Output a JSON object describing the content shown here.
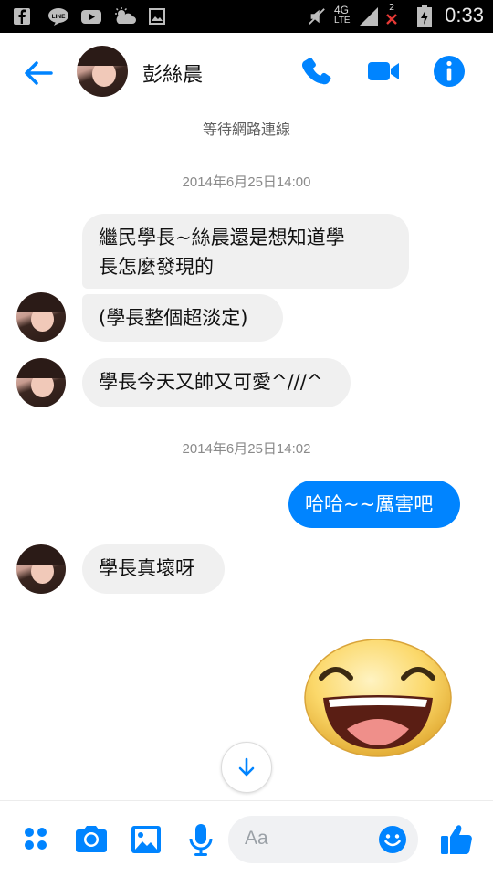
{
  "status_bar": {
    "time": "0:33",
    "network": "4G",
    "network_sub": "LTE",
    "sim_slot": "2",
    "icons": [
      "facebook-icon",
      "line-icon",
      "youtube-icon",
      "weather-icon",
      "image-icon",
      "mute-icon",
      "signal-icon",
      "no-signal-icon",
      "battery-charging-icon"
    ]
  },
  "header": {
    "contact_name": "彭絲晨",
    "icons": [
      "back-arrow-icon",
      "phone-icon",
      "video-icon",
      "info-icon"
    ]
  },
  "connection_status": "等待網路連線",
  "messages": [
    {
      "type": "timestamp",
      "text": "2014年6月25日14:00"
    },
    {
      "type": "received",
      "text_line1": "繼民學長~絲晨還是想知道學",
      "text_line2": "長怎麼發現的"
    },
    {
      "type": "received",
      "text": "(學長整個超淡定)"
    },
    {
      "type": "received",
      "text": "學長今天又帥又可愛^///^"
    },
    {
      "type": "timestamp",
      "text": "2014年6月25日14:02"
    },
    {
      "type": "sent",
      "text": "哈哈~~厲害吧"
    },
    {
      "type": "received",
      "text": "學長真壞呀"
    },
    {
      "type": "sticker",
      "name": "laughing-face-sticker"
    }
  ],
  "composer": {
    "placeholder": "Aa",
    "icons": [
      "more-apps-icon",
      "camera-icon",
      "gallery-icon",
      "microphone-icon",
      "emoji-icon",
      "like-thumb-icon"
    ]
  },
  "colors": {
    "accent": "#0084ff",
    "bubble_received": "#f0f0f0",
    "statusbar": "#000000"
  }
}
